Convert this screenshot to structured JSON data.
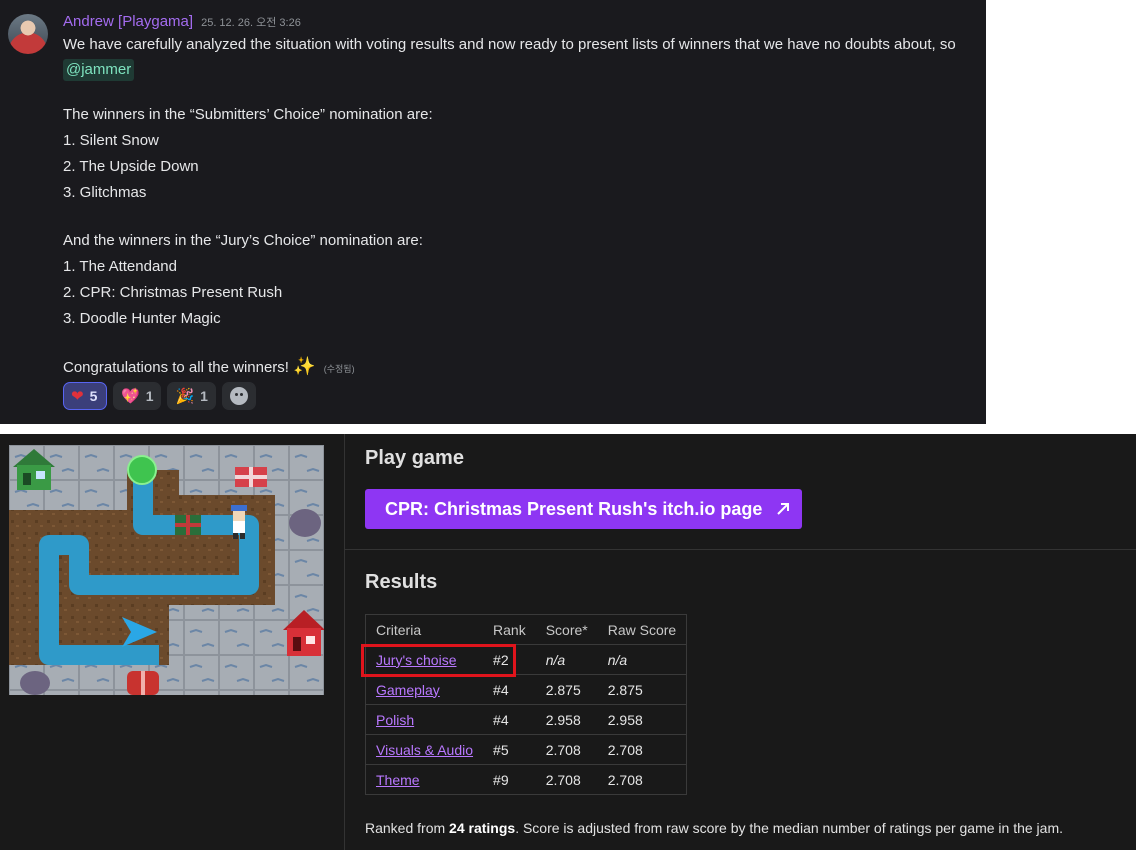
{
  "message": {
    "author": "Andrew [Playgama]",
    "timestamp": "25. 12. 26. 오전 3:26",
    "intro": "We have carefully analyzed the situation with voting results and now ready to present lists of winners that we have no doubts about, so",
    "mention": "@jammer",
    "submitters_heading": "The winners in the “Submitters’ Choice” nomination are:",
    "submitters": [
      "1. Silent Snow",
      "2. The Upside Down",
      "3. Glitchmas"
    ],
    "jury_heading": "And the winners in the “Jury’s Choice” nomination are:",
    "jury": [
      "1. The Attendand",
      "2. CPR: Christmas Present Rush",
      "3. Doodle Hunter Magic"
    ],
    "congrats": "Congratulations to all the winners!",
    "sparkle_emoji": "✨",
    "edited_label": "(수정됨)",
    "reactions": [
      {
        "icon": "heart-icon",
        "glyph": "❤",
        "count": "5",
        "active": true
      },
      {
        "icon": "heart-sparkle-icon",
        "glyph": "💖",
        "count": "1",
        "active": false
      },
      {
        "icon": "party-popper-icon",
        "glyph": "🎉",
        "count": "1",
        "active": false
      }
    ]
  },
  "itch": {
    "play_heading": "Play game",
    "play_button": "CPR: Christmas Present Rush's itch.io page",
    "results_heading": "Results",
    "table": {
      "headers": [
        "Criteria",
        "Rank",
        "Score*",
        "Raw Score"
      ],
      "rows": [
        {
          "criteria": "Jury's choise",
          "rank": "#2",
          "score": "n/a",
          "raw": "n/a"
        },
        {
          "criteria": "Gameplay",
          "rank": "#4",
          "score": "2.875",
          "raw": "2.875"
        },
        {
          "criteria": "Polish",
          "rank": "#4",
          "score": "2.958",
          "raw": "2.958"
        },
        {
          "criteria": "Visuals & Audio",
          "rank": "#5",
          "score": "2.708",
          "raw": "2.708"
        },
        {
          "criteria": "Theme",
          "rank": "#9",
          "score": "2.708",
          "raw": "2.708"
        }
      ]
    },
    "footnote_pre": "Ranked from ",
    "footnote_bold": "24 ratings",
    "footnote_post": ". Score is adjusted from raw score by the median number of ratings per game in the jam.",
    "colors": {
      "button": "#8e36f3",
      "link": "#b978ff",
      "highlight": "#e0141c"
    }
  }
}
